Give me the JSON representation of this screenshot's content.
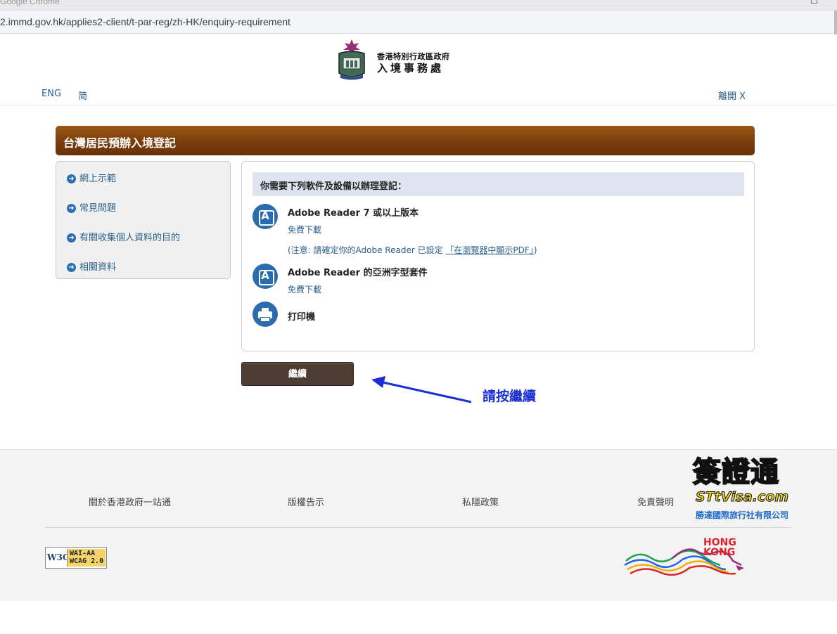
{
  "browser": {
    "window_title": "Google Chrome",
    "url": "2.immd.gov.hk/applies2-client/t-par-reg/zh-HK/enquiry-requirement"
  },
  "header": {
    "dept_line1": "香港特別行政區政府",
    "dept_line2": "入境事務處",
    "lang_eng": "ENG",
    "lang_sc": "简",
    "leave": "離開 X"
  },
  "page": {
    "title": "台灣居民預辦入境登記"
  },
  "sidebar": {
    "items": [
      {
        "label": "網上示範"
      },
      {
        "label": "常見問題"
      },
      {
        "label": "有關收集個人資料的目的"
      },
      {
        "label": "相關資料"
      }
    ]
  },
  "requirements": {
    "heading": "你需要下列軟件及設備以辦理登記：",
    "items": [
      {
        "title": "Adobe Reader 7 或以上版本",
        "link": "免費下載",
        "note_prefix": "(注意: 請確定你的Adobe Reader 已設定 ",
        "note_link": "「在瀏覽器中顯示PDF」",
        "note_suffix": ")",
        "icon": "adobe-icon"
      },
      {
        "title": "Adobe Reader 的亞洲字型套件",
        "link": "免費下載",
        "icon": "adobe-icon"
      },
      {
        "title": "打印機",
        "icon": "printer-icon"
      }
    ]
  },
  "actions": {
    "continue_label": "繼續"
  },
  "annotation": {
    "text": "請按繼續",
    "color": "#1b2fd4"
  },
  "footer": {
    "links": [
      "關於香港政府一站通",
      "版權告示",
      "私隱政策",
      "免責聲明"
    ],
    "w3c_left": "W3C",
    "w3c_line1": "WAI-AA",
    "w3c_line2": "WCAG 2.0",
    "hk_line1": "HONG",
    "hk_line2": "KONG"
  },
  "watermark": {
    "big": "簽證通",
    "url": "STtVisa.com",
    "company": "勝達國際旅行社有限公司"
  },
  "colors": {
    "title_bar": "#7a3d0c",
    "link": "#2c5f8a",
    "button": "#4e3d33",
    "req_head_bg": "#dfe4f1"
  }
}
